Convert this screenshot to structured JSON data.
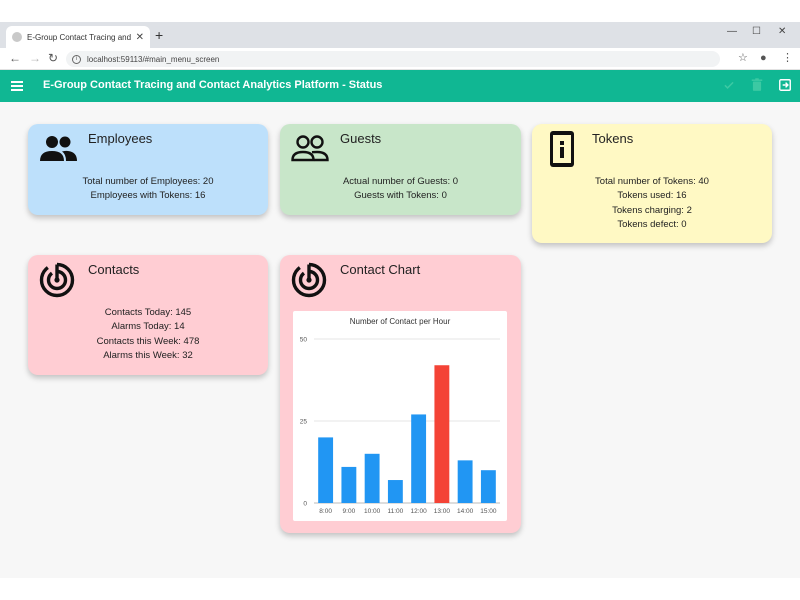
{
  "browser": {
    "tab_title": "E-Group Contact Tracing and Co",
    "url": "localhost:59113/#main_menu_screen"
  },
  "app": {
    "title": "E-Group Contact Tracing and Contact Analytics Platform - Status",
    "accent_color": "#10b793"
  },
  "employees": {
    "title": "Employees",
    "lines": [
      "Total number of Employees: 20",
      "Employees with Tokens: 16"
    ]
  },
  "guests": {
    "title": "Guests",
    "lines": [
      "Actual number of Guests: 0",
      "Guests with Tokens: 0"
    ]
  },
  "tokens": {
    "title": "Tokens",
    "lines": [
      "Total number of Tokens: 40",
      "Tokens used: 16",
      "Tokens charging: 2",
      "Tokens defect: 0"
    ]
  },
  "contacts": {
    "title": "Contacts",
    "lines": [
      "Contacts Today: 145",
      "Alarms Today: 14",
      "Contacts this Week: 478",
      "Alarms this Week: 32"
    ]
  },
  "contact_chart": {
    "title": "Contact Chart"
  },
  "icons": {
    "menu": "menu-icon",
    "check": "check-icon",
    "delete": "delete-icon",
    "exit": "exit-icon",
    "employees": "people-icon",
    "guests": "people-outline-icon",
    "tokens": "token-device-icon",
    "contacts": "radar-icon",
    "chart": "radar-icon"
  },
  "chart_data": {
    "type": "bar",
    "title": "Number of Contact per Hour",
    "categories": [
      "8:00",
      "9:00",
      "10:00",
      "11:00",
      "12:00",
      "13:00",
      "14:00",
      "15:00"
    ],
    "values": [
      20,
      11,
      15,
      7,
      27,
      42,
      13,
      10
    ],
    "highlight_index": 5,
    "ylim": [
      0,
      50
    ],
    "yticks": [
      0,
      25,
      50
    ],
    "bar_color": "#2196f3",
    "highlight_color": "#f44336",
    "grid": true
  }
}
